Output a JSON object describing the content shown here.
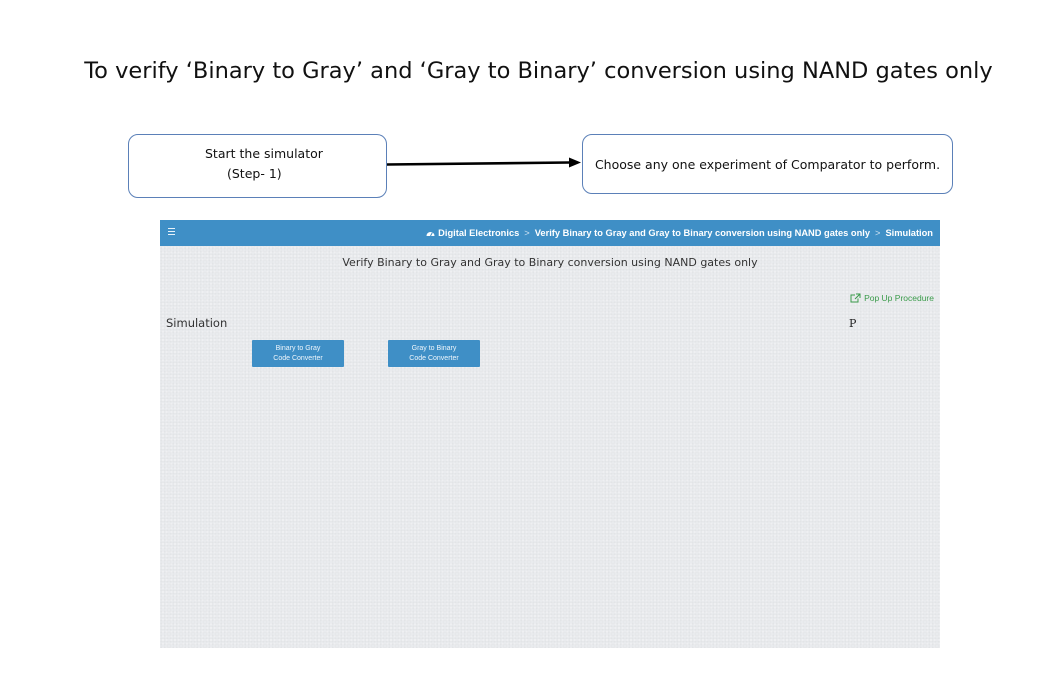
{
  "title": "To verify ‘Binary to Gray’ and ‘Gray to Binary’ conversion using NAND gates only",
  "flow": {
    "start_line1": "Start the simulator",
    "start_line2": "(Step- 1)",
    "choose": "Choose any one experiment of Comparator to perform."
  },
  "simulator": {
    "breadcrumb": {
      "home": "Digital Electronics",
      "sep1": ">",
      "experiment": "Verify Binary to Gray and Gray to Binary conversion using NAND gates only",
      "sep2": ">",
      "current": "Simulation",
      "home_icon": "dashboard-icon"
    },
    "menu_icon": "hamburger-icon",
    "heading": "Verify Binary to Gray and Gray to Binary conversion using NAND gates only",
    "popup_link": "Pop Up Procedure",
    "popup_icon": "external-link-icon",
    "p_glyph": "P",
    "section_label": "Simulation",
    "buttons": [
      {
        "line1": "Binary to Gray",
        "line2": "Code Converter"
      },
      {
        "line1": "Gray to Binary",
        "line2": "Code Converter"
      }
    ],
    "colors": {
      "topbar": "#3f8fc6",
      "button": "#3f8fc6",
      "link": "#3a9b4a",
      "panel_bg": "#e9ebee"
    }
  }
}
